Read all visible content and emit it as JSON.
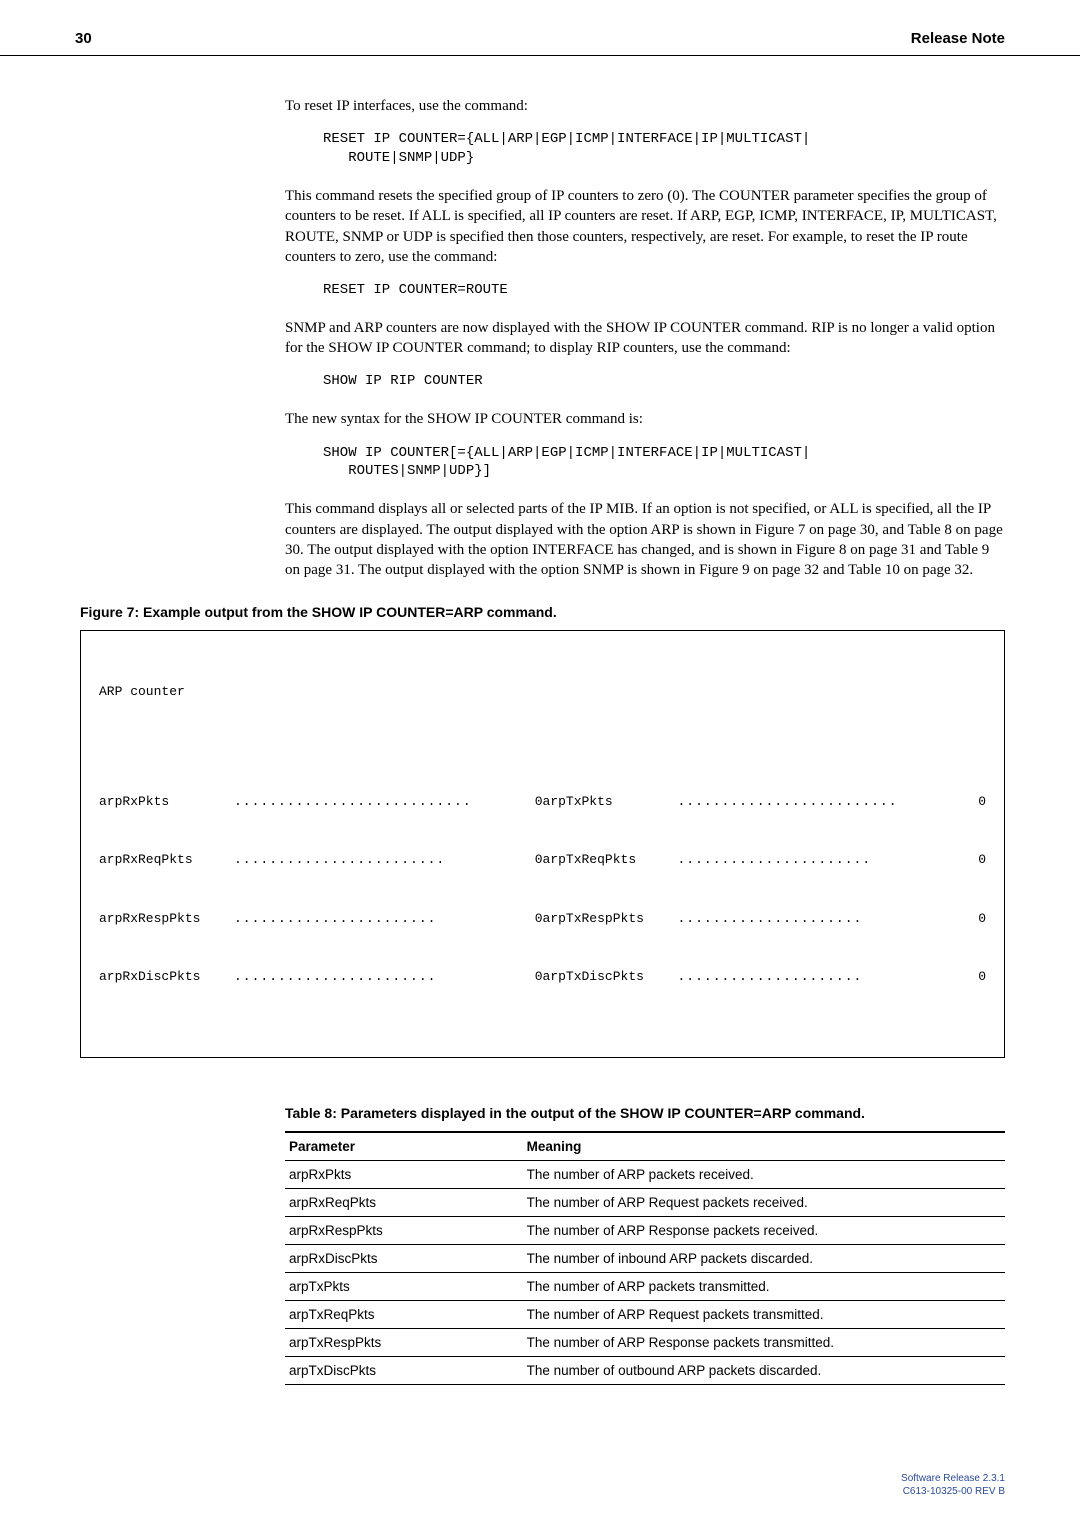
{
  "header": {
    "page_number": "30",
    "doc_title": "Release Note"
  },
  "body": {
    "p1": "To reset IP interfaces, use the command:",
    "code1": "RESET IP COUNTER={ALL|ARP|EGP|ICMP|INTERFACE|IP|MULTICAST|\n   ROUTE|SNMP|UDP}",
    "p2": "This command resets the specified group of IP counters to zero (0). The COUNTER parameter specifies the group of counters to be reset. If ALL is specified, all IP counters are reset. If ARP, EGP, ICMP, INTERFACE, IP, MULTICAST, ROUTE, SNMP or UDP is specified then those counters, respectively, are reset. For example, to reset the IP route counters to zero, use the command:",
    "code2": "RESET IP COUNTER=ROUTE",
    "p3": "SNMP and ARP counters are now displayed with the SHOW IP COUNTER command. RIP is no longer a valid option for the SHOW IP COUNTER command; to display RIP counters, use the command:",
    "code3": "SHOW IP RIP COUNTER",
    "p4": "The new syntax for the SHOW IP COUNTER command is:",
    "code4": "SHOW IP COUNTER[={ALL|ARP|EGP|ICMP|INTERFACE|IP|MULTICAST|\n   ROUTES|SNMP|UDP}]",
    "p5": "This command displays all or selected parts of the IP MIB. If an option is not specified, or ALL is specified, all the IP counters are displayed. The output displayed with the option ARP is shown in Figure 7 on page 30, and Table 8 on page 30. The output displayed with the option INTERFACE has changed, and is shown in Figure 8 on page 31 and Table 9 on page 31. The output displayed with the option SNMP is shown in Figure 9 on page 32 and Table 10 on page 32."
  },
  "figure": {
    "caption": "Figure 7: Example output from the SHOW IP COUNTER=ARP command.",
    "title": "ARP counter",
    "left": [
      {
        "label": "arpRxPkts",
        "value": "0"
      },
      {
        "label": "arpRxReqPkts",
        "value": "0"
      },
      {
        "label": "arpRxRespPkts",
        "value": "0"
      },
      {
        "label": "arpRxDiscPkts",
        "value": "0"
      }
    ],
    "right": [
      {
        "label": "arpTxPkts",
        "value": "0"
      },
      {
        "label": "arpTxReqPkts",
        "value": "0"
      },
      {
        "label": "arpTxRespPkts",
        "value": "0"
      },
      {
        "label": "arpTxDiscPkts",
        "value": "0"
      }
    ]
  },
  "table": {
    "caption": "Table 8: Parameters displayed in the output of the SHOW IP COUNTER=ARP command.",
    "headers": {
      "param": "Parameter",
      "meaning": "Meaning"
    },
    "rows": [
      {
        "param": "arpRxPkts",
        "meaning": "The number of ARP packets received."
      },
      {
        "param": "arpRxReqPkts",
        "meaning": "The number of ARP Request packets received."
      },
      {
        "param": "arpRxRespPkts",
        "meaning": "The number of ARP Response packets received."
      },
      {
        "param": "arpRxDiscPkts",
        "meaning": "The number of inbound ARP packets discarded."
      },
      {
        "param": "arpTxPkts",
        "meaning": "The number of ARP packets transmitted."
      },
      {
        "param": "arpTxReqPkts",
        "meaning": "The number of ARP Request packets transmitted."
      },
      {
        "param": "arpTxRespPkts",
        "meaning": "The number of ARP Response packets transmitted."
      },
      {
        "param": "arpTxDiscPkts",
        "meaning": "The number of outbound ARP packets discarded."
      }
    ]
  },
  "footer": {
    "line1": "Software Release 2.3.1",
    "line2": "C613-10325-00 REV B"
  }
}
